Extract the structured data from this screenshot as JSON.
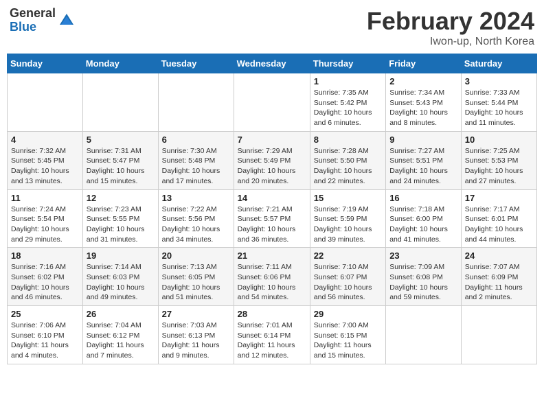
{
  "header": {
    "logo_general": "General",
    "logo_blue": "Blue",
    "title": "February 2024",
    "location": "Iwon-up, North Korea"
  },
  "weekdays": [
    "Sunday",
    "Monday",
    "Tuesday",
    "Wednesday",
    "Thursday",
    "Friday",
    "Saturday"
  ],
  "weeks": [
    [
      {
        "num": "",
        "info": ""
      },
      {
        "num": "",
        "info": ""
      },
      {
        "num": "",
        "info": ""
      },
      {
        "num": "",
        "info": ""
      },
      {
        "num": "1",
        "info": "Sunrise: 7:35 AM\nSunset: 5:42 PM\nDaylight: 10 hours and 6 minutes."
      },
      {
        "num": "2",
        "info": "Sunrise: 7:34 AM\nSunset: 5:43 PM\nDaylight: 10 hours and 8 minutes."
      },
      {
        "num": "3",
        "info": "Sunrise: 7:33 AM\nSunset: 5:44 PM\nDaylight: 10 hours and 11 minutes."
      }
    ],
    [
      {
        "num": "4",
        "info": "Sunrise: 7:32 AM\nSunset: 5:45 PM\nDaylight: 10 hours and 13 minutes."
      },
      {
        "num": "5",
        "info": "Sunrise: 7:31 AM\nSunset: 5:47 PM\nDaylight: 10 hours and 15 minutes."
      },
      {
        "num": "6",
        "info": "Sunrise: 7:30 AM\nSunset: 5:48 PM\nDaylight: 10 hours and 17 minutes."
      },
      {
        "num": "7",
        "info": "Sunrise: 7:29 AM\nSunset: 5:49 PM\nDaylight: 10 hours and 20 minutes."
      },
      {
        "num": "8",
        "info": "Sunrise: 7:28 AM\nSunset: 5:50 PM\nDaylight: 10 hours and 22 minutes."
      },
      {
        "num": "9",
        "info": "Sunrise: 7:27 AM\nSunset: 5:51 PM\nDaylight: 10 hours and 24 minutes."
      },
      {
        "num": "10",
        "info": "Sunrise: 7:25 AM\nSunset: 5:53 PM\nDaylight: 10 hours and 27 minutes."
      }
    ],
    [
      {
        "num": "11",
        "info": "Sunrise: 7:24 AM\nSunset: 5:54 PM\nDaylight: 10 hours and 29 minutes."
      },
      {
        "num": "12",
        "info": "Sunrise: 7:23 AM\nSunset: 5:55 PM\nDaylight: 10 hours and 31 minutes."
      },
      {
        "num": "13",
        "info": "Sunrise: 7:22 AM\nSunset: 5:56 PM\nDaylight: 10 hours and 34 minutes."
      },
      {
        "num": "14",
        "info": "Sunrise: 7:21 AM\nSunset: 5:57 PM\nDaylight: 10 hours and 36 minutes."
      },
      {
        "num": "15",
        "info": "Sunrise: 7:19 AM\nSunset: 5:59 PM\nDaylight: 10 hours and 39 minutes."
      },
      {
        "num": "16",
        "info": "Sunrise: 7:18 AM\nSunset: 6:00 PM\nDaylight: 10 hours and 41 minutes."
      },
      {
        "num": "17",
        "info": "Sunrise: 7:17 AM\nSunset: 6:01 PM\nDaylight: 10 hours and 44 minutes."
      }
    ],
    [
      {
        "num": "18",
        "info": "Sunrise: 7:16 AM\nSunset: 6:02 PM\nDaylight: 10 hours and 46 minutes."
      },
      {
        "num": "19",
        "info": "Sunrise: 7:14 AM\nSunset: 6:03 PM\nDaylight: 10 hours and 49 minutes."
      },
      {
        "num": "20",
        "info": "Sunrise: 7:13 AM\nSunset: 6:05 PM\nDaylight: 10 hours and 51 minutes."
      },
      {
        "num": "21",
        "info": "Sunrise: 7:11 AM\nSunset: 6:06 PM\nDaylight: 10 hours and 54 minutes."
      },
      {
        "num": "22",
        "info": "Sunrise: 7:10 AM\nSunset: 6:07 PM\nDaylight: 10 hours and 56 minutes."
      },
      {
        "num": "23",
        "info": "Sunrise: 7:09 AM\nSunset: 6:08 PM\nDaylight: 10 hours and 59 minutes."
      },
      {
        "num": "24",
        "info": "Sunrise: 7:07 AM\nSunset: 6:09 PM\nDaylight: 11 hours and 2 minutes."
      }
    ],
    [
      {
        "num": "25",
        "info": "Sunrise: 7:06 AM\nSunset: 6:10 PM\nDaylight: 11 hours and 4 minutes."
      },
      {
        "num": "26",
        "info": "Sunrise: 7:04 AM\nSunset: 6:12 PM\nDaylight: 11 hours and 7 minutes."
      },
      {
        "num": "27",
        "info": "Sunrise: 7:03 AM\nSunset: 6:13 PM\nDaylight: 11 hours and 9 minutes."
      },
      {
        "num": "28",
        "info": "Sunrise: 7:01 AM\nSunset: 6:14 PM\nDaylight: 11 hours and 12 minutes."
      },
      {
        "num": "29",
        "info": "Sunrise: 7:00 AM\nSunset: 6:15 PM\nDaylight: 11 hours and 15 minutes."
      },
      {
        "num": "",
        "info": ""
      },
      {
        "num": "",
        "info": ""
      }
    ]
  ]
}
